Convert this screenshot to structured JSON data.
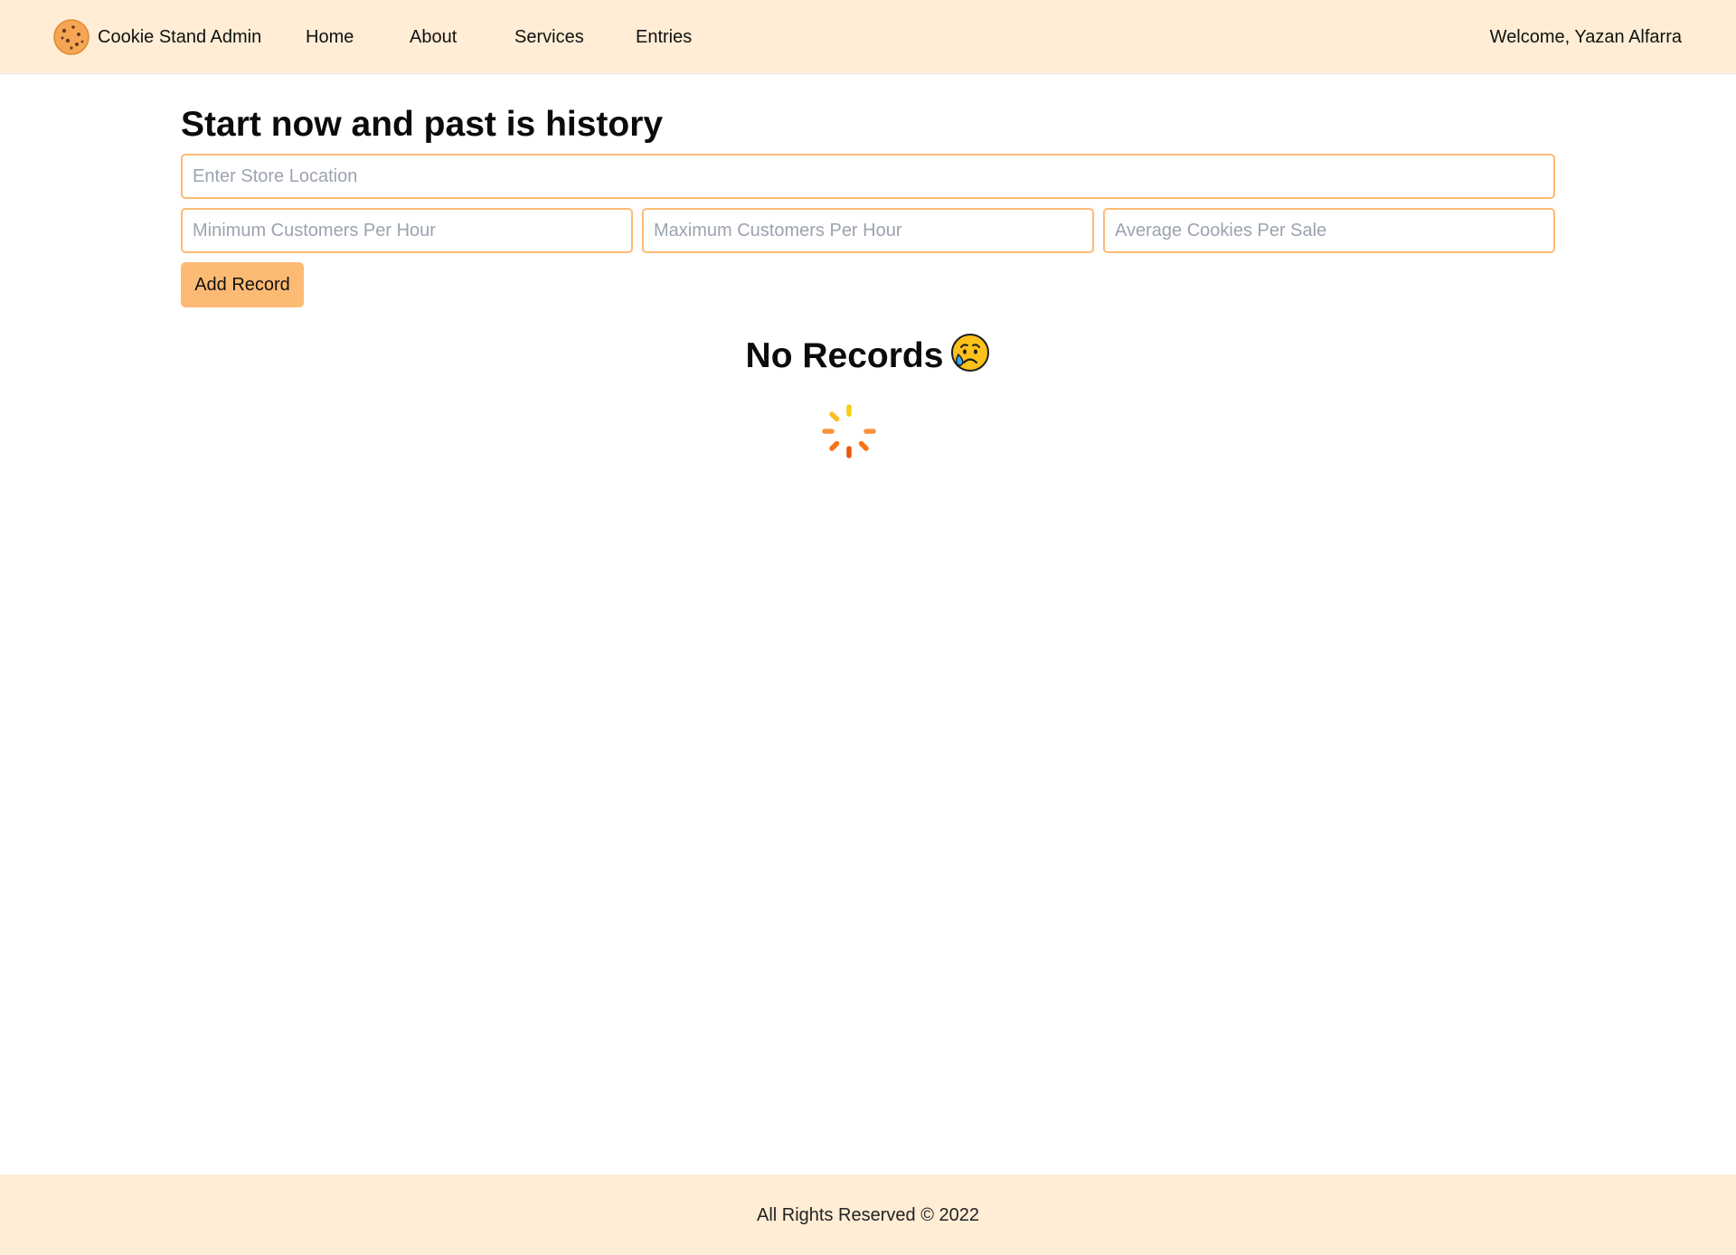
{
  "header": {
    "brand_label": "Cookie Stand Admin",
    "nav": {
      "home": "Home",
      "about": "About",
      "services": "Services",
      "entries": "Entries"
    },
    "welcome": "Welcome, Yazan Alfarra"
  },
  "main": {
    "title": "Start now and past is history",
    "form": {
      "location_placeholder": "Enter Store Location",
      "min_placeholder": "Minimum Customers Per Hour",
      "max_placeholder": "Maximum Customers Per Hour",
      "avg_placeholder": "Average Cookies Per Sale",
      "submit_label": "Add Record"
    },
    "empty_state": "No Records"
  },
  "footer": {
    "text": "All Rights Reserved © 2022"
  },
  "icons": {
    "brand": "cookie-icon",
    "empty_state": "sad-tear-face-icon",
    "loading": "loading-spinner-icon"
  },
  "colors": {
    "header_bg": "#ffedd5",
    "accent": "#fdba74",
    "spinner_yellow": "#facc15",
    "spinner_orange": "#f97316"
  }
}
